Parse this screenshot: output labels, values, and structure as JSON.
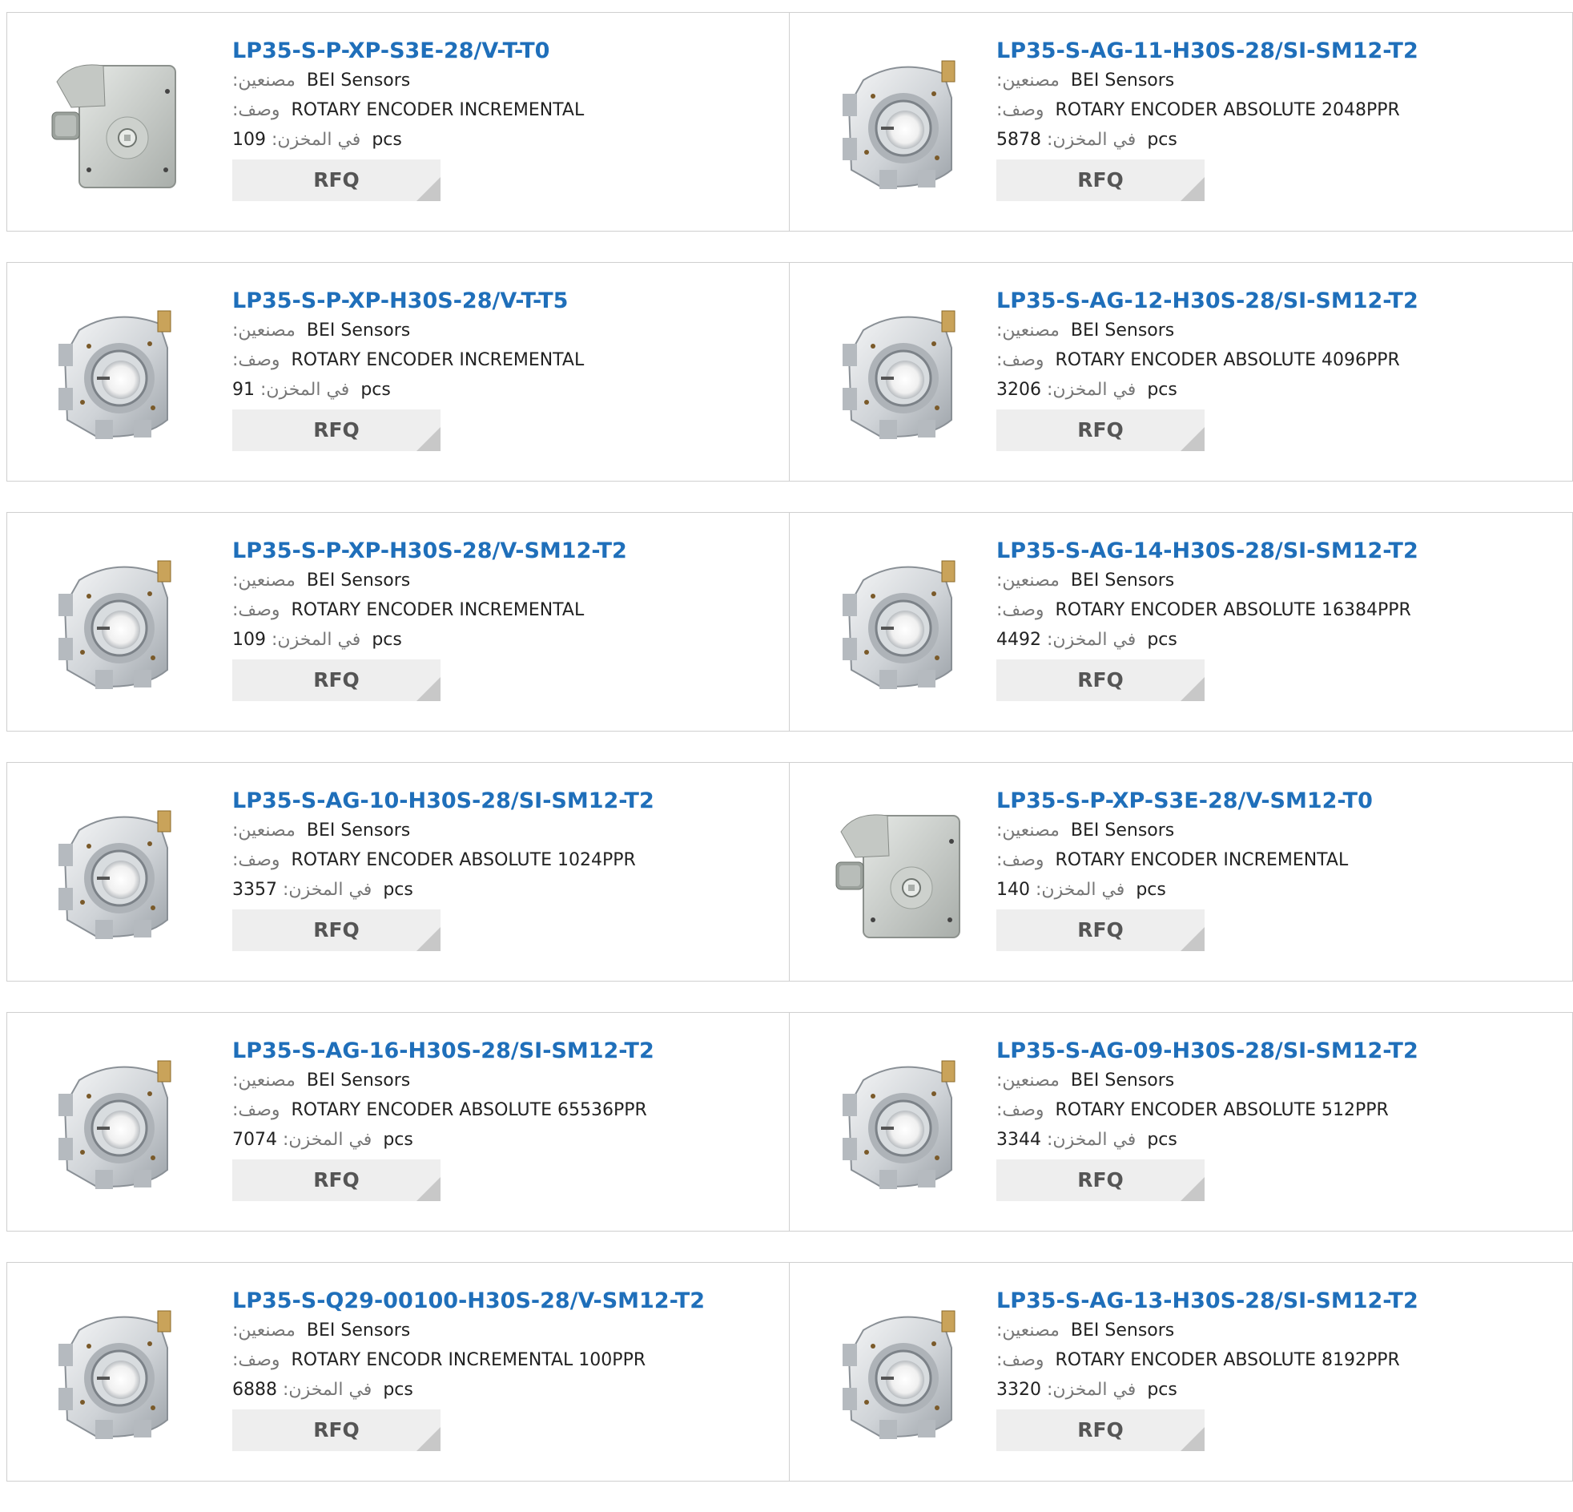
{
  "labels": {
    "manufacturer": ":مصنعين",
    "description": ":وصف",
    "stock": ":في المخزن",
    "unit": "pcs",
    "rfq": "RFQ"
  },
  "products": [
    {
      "part": "LP35-S-P-XP-S3E-28/V-T-T0",
      "manufacturer": "BEI Sensors",
      "description": "ROTARY ENCODER INCREMENTAL",
      "stock": "109",
      "image": "box-encoder-icon"
    },
    {
      "part": "LP35-S-AG-11-H30S-28/SI-SM12-T2",
      "manufacturer": "BEI Sensors",
      "description": "ROTARY ENCODER ABSOLUTE 2048PPR",
      "stock": "5878",
      "image": "hollow-shaft-encoder-icon"
    },
    {
      "part": "LP35-S-P-XP-H30S-28/V-T-T5",
      "manufacturer": "BEI Sensors",
      "description": "ROTARY ENCODER INCREMENTAL",
      "stock": "91",
      "image": "hollow-shaft-encoder-icon"
    },
    {
      "part": "LP35-S-AG-12-H30S-28/SI-SM12-T2",
      "manufacturer": "BEI Sensors",
      "description": "ROTARY ENCODER ABSOLUTE 4096PPR",
      "stock": "3206",
      "image": "hollow-shaft-encoder-icon"
    },
    {
      "part": "LP35-S-P-XP-H30S-28/V-SM12-T2",
      "manufacturer": "BEI Sensors",
      "description": "ROTARY ENCODER INCREMENTAL",
      "stock": "109",
      "image": "hollow-shaft-encoder-icon"
    },
    {
      "part": "LP35-S-AG-14-H30S-28/SI-SM12-T2",
      "manufacturer": "BEI Sensors",
      "description": "ROTARY ENCODER ABSOLUTE 16384PPR",
      "stock": "4492",
      "image": "hollow-shaft-encoder-icon"
    },
    {
      "part": "LP35-S-AG-10-H30S-28/SI-SM12-T2",
      "manufacturer": "BEI Sensors",
      "description": "ROTARY ENCODER ABSOLUTE 1024PPR",
      "stock": "3357",
      "image": "hollow-shaft-encoder-icon"
    },
    {
      "part": "LP35-S-P-XP-S3E-28/V-SM12-T0",
      "manufacturer": "BEI Sensors",
      "description": "ROTARY ENCODER INCREMENTAL",
      "stock": "140",
      "image": "box-encoder-icon"
    },
    {
      "part": "LP35-S-AG-16-H30S-28/SI-SM12-T2",
      "manufacturer": "BEI Sensors",
      "description": "ROTARY ENCODER ABSOLUTE 65536PPR",
      "stock": "7074",
      "image": "hollow-shaft-encoder-icon"
    },
    {
      "part": "LP35-S-AG-09-H30S-28/SI-SM12-T2",
      "manufacturer": "BEI Sensors",
      "description": "ROTARY ENCODER ABSOLUTE 512PPR",
      "stock": "3344",
      "image": "hollow-shaft-encoder-icon"
    },
    {
      "part": "LP35-S-Q29-00100-H30S-28/V-SM12-T2",
      "manufacturer": "BEI Sensors",
      "description": "ROTARY ENCODR INCREMENTAL 100PPR",
      "stock": "6888",
      "image": "hollow-shaft-encoder-icon"
    },
    {
      "part": "LP35-S-AG-13-H30S-28/SI-SM12-T2",
      "manufacturer": "BEI Sensors",
      "description": "ROTARY ENCODER ABSOLUTE 8192PPR",
      "stock": "3320",
      "image": "hollow-shaft-encoder-icon"
    }
  ]
}
